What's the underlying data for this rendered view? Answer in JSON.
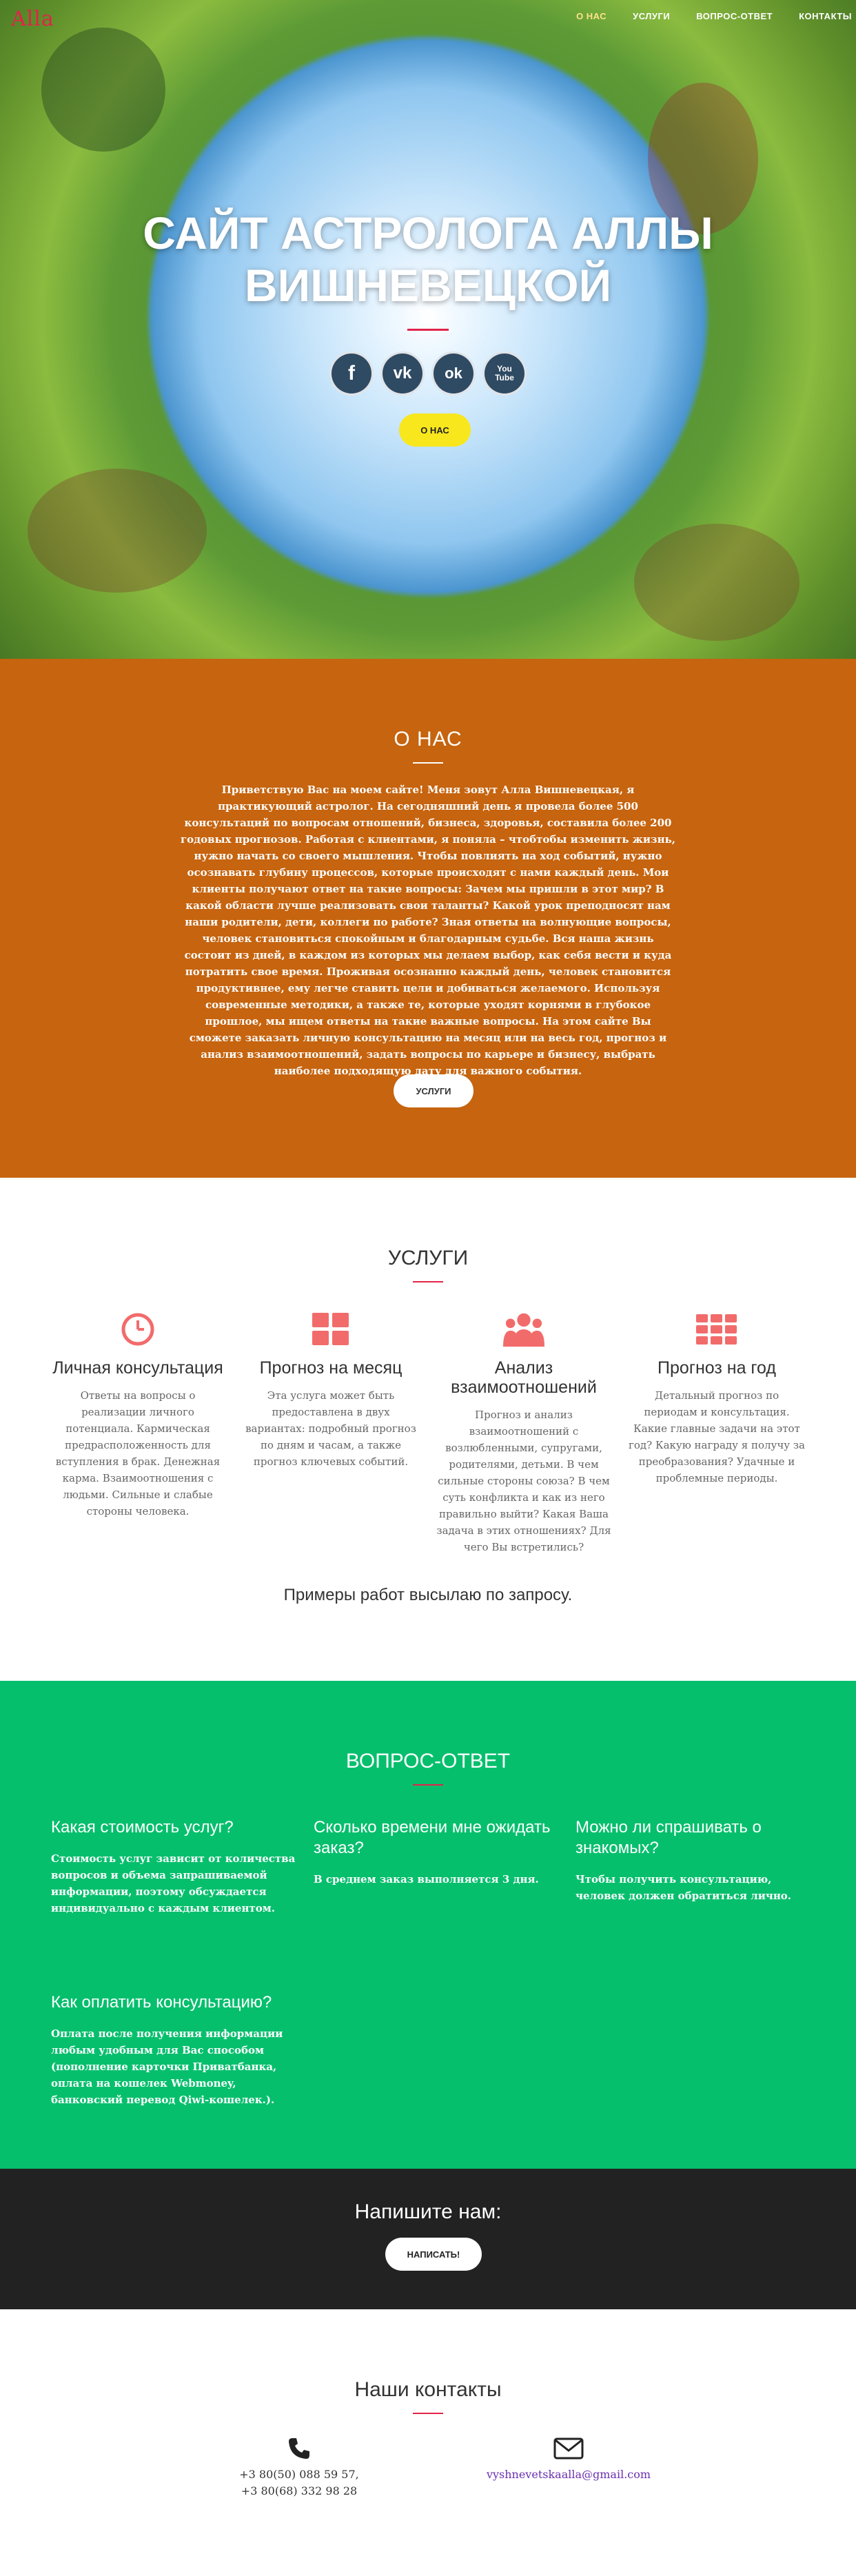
{
  "nav": {
    "logo": "Alla",
    "items": [
      "О НАС",
      "УСЛУГИ",
      "ВОПРОС-ОТВЕТ",
      "КОНТАКТЫ"
    ]
  },
  "hero": {
    "title_line1": "САЙТ АСТРОЛОГА АЛЛЫ",
    "title_line2": "ВИШНЕВЕЦКОЙ",
    "socials": [
      {
        "name": "facebook",
        "glyph": "f"
      },
      {
        "name": "vkontakte",
        "glyph": "vk"
      },
      {
        "name": "odnoklassniki",
        "glyph": "ok"
      },
      {
        "name": "youtube",
        "glyph": "You Tube"
      }
    ],
    "button": "О НАС"
  },
  "about": {
    "title": "О НАС",
    "text": "Приветствую Вас на моем сайте! Меня зовут Алла Вишневецкая, я практикующий астролог. На сегодняшний день я провела более 500 консультаций по вопросам отношений, бизнеса, здоровья, составила более 200 годовых прогнозов. Работая с клиентами, я поняла – чтобтобы изменить жизнь, нужно начать со своего мышления. Чтобы повлиять на ход событий, нужно осознавать глубину процессов, которые происходят с нами каждый день. Мои клиенты получают ответ на такие вопросы: Зачем мы пришли в этот мир? В какой области лучше реализовать свои таланты? Какой урок преподносят нам наши родители, дети, коллеги по работе? Зная ответы на волнующие вопросы, человек становиться спокойным и благодарным судьбе. Вся наша жизнь состоит из дней, в каждом из которых мы делаем выбор, как себя вести и куда потратить свое время. Проживая осознанно каждый день, человек становится продуктивнее, ему легче ставить цели и добиваться желаемого. Используя современные методики, а также те, которые уходят корнями в глубокое прошлое, мы ищем ответы на такие важные вопросы. На этом сайте Вы сможете заказать личную консультацию на месяц или на весь год, прогноз и анализ взаимоотношений, задать вопросы по карьере и бизнесу, выбрать наиболее подходящую дату для важного события.",
    "button": "УСЛУГИ"
  },
  "services": {
    "title": "УСЛУГИ",
    "items": [
      {
        "icon": "clock-icon",
        "title": "Личная консультация",
        "text": "Ответы на вопросы о реализации личного потенциала. Кармическая предрасположенность для вступления в брак. Денежная карма. Взаимоотношения с людьми. Сильные и слабые стороны человека."
      },
      {
        "icon": "grid-icon",
        "title": "Прогноз на месяц",
        "text": "Эта услуга может быть предоставлена в двух вариантах: подробный прогноз по дням и часам, а также прогноз ключевых событий."
      },
      {
        "icon": "group-icon",
        "title": "Анализ взаимоотношений",
        "text": "Прогноз и анализ взаимоотношений с возлюбленными, супругами, родителями, детьми. В чем сильные стороны союза? В чем суть конфликта и как из него правильно выйти? Какая Ваша задача в этих отношениях? Для чего Вы встретились?"
      },
      {
        "icon": "calendar-grid-icon",
        "title": "Прогноз на год",
        "text": "Детальный прогноз по периодам и консультация. Какие главные задачи на этот год? Какую награду я получу за преобразования? Удачные и проблемные периоды."
      }
    ],
    "note": "Примеры работ высылаю по запросу."
  },
  "faq": {
    "title": "ВОПРОС-ОТВЕТ",
    "items": [
      {
        "q": "Какая стоимость услуг?",
        "a": "Стоимость услуг зависит от количества вопросов и объема запрашиваемой информации, поэтому обсуждается индивидуально с каждым клиентом."
      },
      {
        "q": "Сколько времени мне ожидать заказ?",
        "a": "В среднем заказ выполняется 3 дня."
      },
      {
        "q": "Можно ли спрашивать о знакомых?",
        "a": "Чтобы получить консультацию, человек должен обратиться лично."
      },
      {
        "q": "Как оплатить консультацию?",
        "a": "Оплата после получения информации любым удобным для Вас способом (пополнение карточки Приватбанка, оплата на кошелек Webmoney, банковский перевод Qiwi-кошелек.)."
      }
    ]
  },
  "write": {
    "title": "Напишите нам:",
    "button": "НАПИСАТЬ!"
  },
  "contacts": {
    "title": "Наши контакты",
    "phone1": "+3 80(50) 088 59 57,",
    "phone2": "+3 80(68) 332 98 28",
    "email": "vyshnevetskaalla@gmail.com"
  },
  "colors": {
    "accent": "#e3234a",
    "about_bg": "#c6640f",
    "faq_bg": "#06bf6d",
    "write_bg": "#222222",
    "hero_button": "#f8e71c",
    "social_bg": "#2f4a63",
    "service_icon": "#f26b6b"
  }
}
